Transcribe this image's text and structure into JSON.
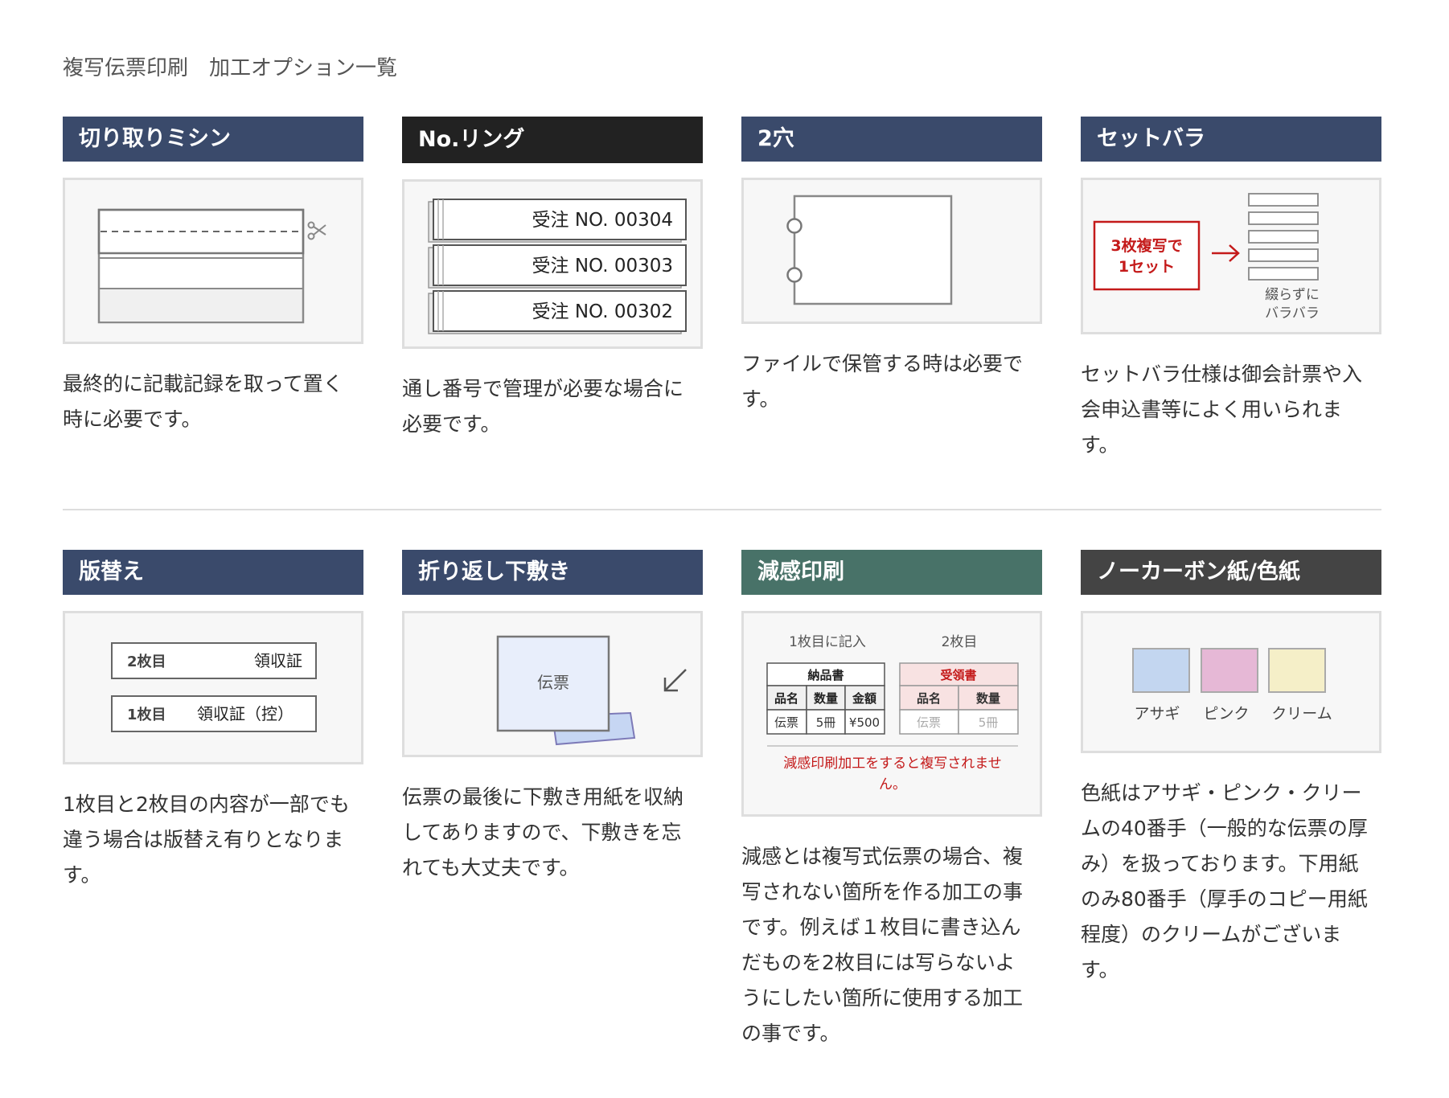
{
  "page": {
    "title": "複写伝票印刷　加工オプション一覧"
  },
  "colors": {
    "navy": "#3a4a6b",
    "black": "#222222",
    "green": "#487268",
    "darkgray": "#444444",
    "red": "#c41a1a"
  },
  "cards": [
    {
      "title": "切り取りミシン",
      "description": "最終的に記載記録を取って置く時に必要です。",
      "illustration": {
        "icon": "scissors-icon"
      }
    },
    {
      "title": "No.リング",
      "description": "通し番号で管理が必要な場合に必要です。",
      "illustration": {
        "numbers": [
          "受注 NO. 00304",
          "受注 NO. 00303",
          "受注 NO. 00302"
        ]
      }
    },
    {
      "title": "2穴",
      "description": "ファイルで保管する時は必要です。",
      "illustration": {}
    },
    {
      "title": "セットバラ",
      "description": "セットバラ仕様は御会計票や入会申込書等によく用いられます。",
      "illustration": {
        "set_label_line1": "3枚複写で",
        "set_label_line2": "1セット",
        "loose_label_line1": "綴らずに",
        "loose_label_line2": "バラバラ"
      }
    },
    {
      "title": "版替え",
      "description": "1枚目と2枚目の内容が一部でも違う場合は版替え有りとなります。",
      "illustration": {
        "rows": [
          {
            "sheet": "2枚目",
            "doc": "領収証"
          },
          {
            "sheet": "1枚目",
            "doc": "領収証（控）"
          }
        ]
      }
    },
    {
      "title": "折り返し下敷き",
      "description": "伝票の最後に下敷き用紙を収納してありますので、下敷きを忘れても大丈夫です。",
      "illustration": {
        "slip_label": "伝票"
      }
    },
    {
      "title": "減感印刷",
      "description": "減感とは複写式伝票の場合、複写されない箇所を作る加工の事です。例えば１枚目に書き込んだものを2枚目には写らないようにしたい箇所に使用する加工の事です。",
      "illustration": {
        "left_caption": "1枚目に記入",
        "right_caption": "2枚目",
        "left_table": {
          "title": "納品書",
          "headers": [
            "品名",
            "数量",
            "金額"
          ],
          "row": [
            "伝票",
            "5冊",
            "¥500"
          ]
        },
        "right_table": {
          "title": "受領書",
          "headers": [
            "品名",
            "数量"
          ],
          "row": [
            "伝票",
            "5冊"
          ]
        },
        "note_line1": "減感印刷加工をすると複写されませ",
        "note_line2": "ん。"
      }
    },
    {
      "title": "ノーカーボン紙/色紙",
      "description": "色紙はアサギ・ピンク・クリームの40番手（一般的な伝票の厚み）を扱っております。下用紙のみ80番手（厚手のコピー用紙程度）のクリームがございます。",
      "illustration": {
        "swatches": [
          {
            "label": "アサギ",
            "color": "#c3d6f0"
          },
          {
            "label": "ピンク",
            "color": "#e6b8d6"
          },
          {
            "label": "クリーム",
            "color": "#f5efc8"
          }
        ]
      }
    }
  ]
}
